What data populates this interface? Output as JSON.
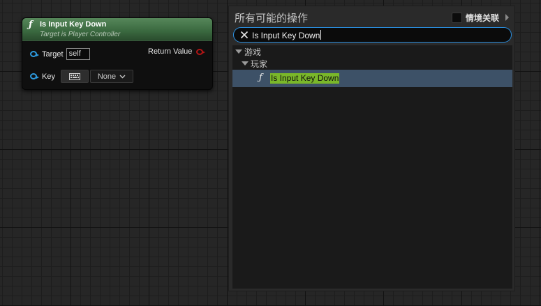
{
  "node": {
    "func_icon": "ƒ",
    "title": "Is Input Key Down",
    "subtitle": "Target is Player Controller",
    "target_label": "Target",
    "target_value": "self",
    "return_label": "Return Value",
    "key_label": "Key",
    "key_icon": "keyboard-icon",
    "key_value": "None"
  },
  "menu": {
    "title": "所有可能的操作",
    "context_label": "情境关联",
    "search_value": "Is Input Key Down",
    "tree": {
      "category": "游戏",
      "subcategory": "玩家",
      "item_icon": "ƒ",
      "item_label": "Is Input Key Down"
    }
  },
  "colors": {
    "node_header": "#3b6a40",
    "exec_pin_blue": "#2d9be0",
    "bool_pin_red": "#b01515",
    "selection": "#3d5167",
    "highlight": "#7ab72a",
    "search_border": "#2a8fe0"
  }
}
